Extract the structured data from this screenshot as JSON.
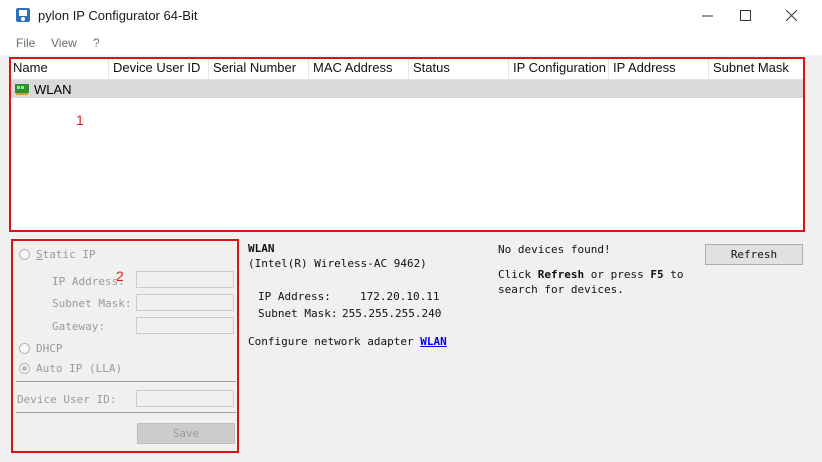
{
  "window": {
    "title": "pylon IP Configurator 64-Bit"
  },
  "menu": [
    "File",
    "View",
    "?"
  ],
  "table": {
    "columns": [
      "Name",
      "Device User ID",
      "Serial Number",
      "MAC Address",
      "Status",
      "IP Configuration",
      "IP Address",
      "Subnet Mask"
    ],
    "rows": [
      {
        "name": "WLAN"
      }
    ]
  },
  "annotations": {
    "list": "1",
    "ip": "2"
  },
  "left_panel": {
    "static_ip": "Static IP",
    "ip_address_label": "IP Address:",
    "subnet_mask_label": "Subnet Mask:",
    "gateway_label": "Gateway:",
    "dhcp": "DHCP",
    "auto_ip": "Auto IP (LLA)",
    "device_user_id_label": "Device User ID:",
    "save": "Save"
  },
  "info": {
    "adapter_name": "WLAN",
    "adapter_desc": "(Intel(R) Wireless-AC 9462)",
    "ip_label": "IP Address:",
    "ip_value": "172.20.10.11",
    "mask_label": "Subnet Mask:",
    "mask_value": "255.255.255.240",
    "configure_prefix": "Configure network adapter",
    "configure_link": "WLAN"
  },
  "right": {
    "no_devices": "No devices found!",
    "click": "Click",
    "refresh_word": "Refresh",
    "or_press": "or press",
    "key": "F5",
    "to": "to",
    "search": "search for devices.",
    "refresh_button": "Refresh"
  },
  "icons": {
    "app": "pylon-icon",
    "adapter": "network-adapter-icon"
  },
  "colors": {
    "highlight": "#d7141a",
    "link": "#0000ee"
  }
}
